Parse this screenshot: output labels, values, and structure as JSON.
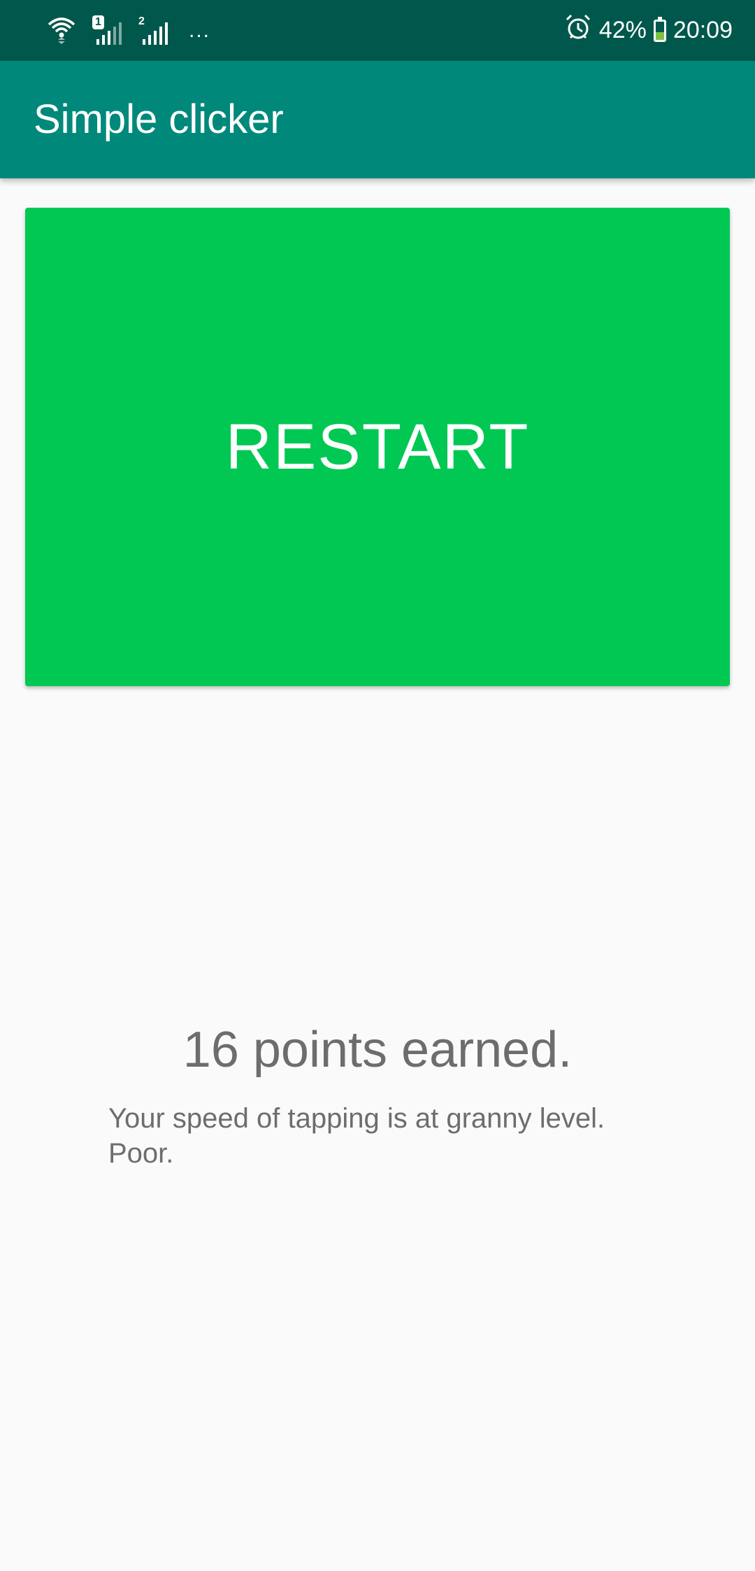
{
  "status_bar": {
    "sim1_label": "1",
    "sim2_label": "2",
    "more_indicator": "...",
    "battery_percent": "42%",
    "time": "20:09",
    "icons": [
      "wifi-icon",
      "signal-icon",
      "signal-icon",
      "alarm-icon",
      "battery-charging-icon"
    ],
    "battery_level": 0.42,
    "colors": {
      "background": "#00574b",
      "battery_fill": "#7cc242"
    }
  },
  "app_bar": {
    "title": "Simple clicker",
    "color": "#00897b"
  },
  "game": {
    "restart_label": "RESTART",
    "button_color": "#00c853",
    "points_text": "16 points earned.",
    "message": "Your speed of tapping is at granny level.\n Poor."
  }
}
